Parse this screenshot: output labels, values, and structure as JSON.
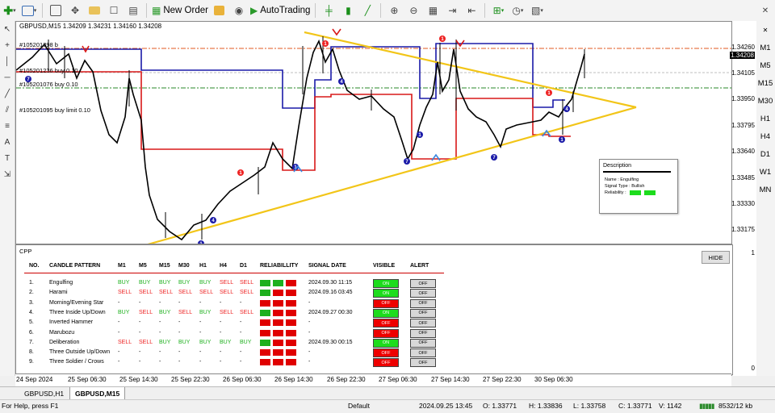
{
  "toolbar": {
    "new_order": "New Order",
    "autotrading": "AutoTrading"
  },
  "chart": {
    "title": "GBPUSD,M15  1.34209 1.34231 1.34160 1.34208",
    "orders": [
      "#105201398 b",
      "#105201236 buy 0.10",
      "#105201076 buy 0.10",
      "#105201095 buy limit 0.10"
    ],
    "price_labels": [
      "1.34260",
      "1.34208",
      "1.34105",
      "1.33950",
      "1.33795",
      "1.33640",
      "1.33485",
      "1.33330",
      "1.33175"
    ],
    "current_price": "1.34208"
  },
  "timeframes": [
    "M1",
    "M5",
    "M15",
    "M30",
    "H1",
    "H4",
    "D1",
    "W1",
    "MN"
  ],
  "description_box": {
    "title": "Description",
    "name": "Name : Engulfing",
    "signal_type": "Signal Type : Bullish",
    "reliability": "Reliability :"
  },
  "panel": {
    "title": "CPP",
    "hide_label": "HIDE",
    "headers": [
      "NO.",
      "CANDLE PATTERN",
      "M1",
      "M5",
      "M15",
      "M30",
      "H1",
      "H4",
      "D1",
      "RELIABILLITY",
      "SIGNAL DATE",
      "VISIBLE",
      "ALERT"
    ],
    "rows": [
      {
        "no": "1.",
        "name": "Engulfing",
        "sig": [
          "BUY",
          "BUY",
          "BUY",
          "BUY",
          "BUY",
          "SELL",
          "SELL"
        ],
        "rel": [
          "g",
          "g",
          "r"
        ],
        "date": "2024.09.30 11:15",
        "visible": "ON",
        "alert": "OFF"
      },
      {
        "no": "2.",
        "name": "Harami",
        "sig": [
          "SELL",
          "SELL",
          "SELL",
          "SELL",
          "SELL",
          "SELL",
          "SELL"
        ],
        "rel": [
          "g",
          "r",
          "r"
        ],
        "date": "2024.09.16 03:45",
        "visible": "ON",
        "alert": "OFF"
      },
      {
        "no": "3.",
        "name": "Morning/Evening Star",
        "sig": [
          "-",
          "-",
          "-",
          "-",
          "-",
          "-",
          "-"
        ],
        "rel": [
          "r",
          "r",
          "r"
        ],
        "date": "-",
        "visible": "OFF",
        "alert": "OFF"
      },
      {
        "no": "4.",
        "name": "Three Inside Up/Down",
        "sig": [
          "BUY",
          "SELL",
          "BUY",
          "SELL",
          "BUY",
          "SELL",
          "SELL"
        ],
        "rel": [
          "g",
          "r",
          "r"
        ],
        "date": "2024.09.27 00:30",
        "visible": "ON",
        "alert": "OFF"
      },
      {
        "no": "5.",
        "name": "Inverted Hammer",
        "sig": [
          "-",
          "-",
          "-",
          "-",
          "-",
          "-",
          "-"
        ],
        "rel": [
          "r",
          "r",
          "r"
        ],
        "date": "-",
        "visible": "OFF",
        "alert": "OFF"
      },
      {
        "no": "6.",
        "name": "Marubozu",
        "sig": [
          "-",
          "-",
          "-",
          "-",
          "-",
          "-",
          "-"
        ],
        "rel": [
          "r",
          "r",
          "r"
        ],
        "date": "-",
        "visible": "OFF",
        "alert": "OFF"
      },
      {
        "no": "7.",
        "name": "Deliberation",
        "sig": [
          "SELL",
          "SELL",
          "BUY",
          "BUY",
          "BUY",
          "BUY",
          "BUY"
        ],
        "rel": [
          "g",
          "r",
          "r"
        ],
        "date": "2024.09.30 00:15",
        "visible": "ON",
        "alert": "OFF"
      },
      {
        "no": "8.",
        "name": "Three Outside Up/Down",
        "sig": [
          "-",
          "-",
          "-",
          "-",
          "-",
          "-",
          "-"
        ],
        "rel": [
          "r",
          "r",
          "r"
        ],
        "date": "-",
        "visible": "OFF",
        "alert": "OFF"
      },
      {
        "no": "9.",
        "name": "Three Soldier / Crows",
        "sig": [
          "-",
          "-",
          "-",
          "-",
          "-",
          "-",
          "-"
        ],
        "rel": [
          "r",
          "r",
          "r"
        ],
        "date": "-",
        "visible": "OFF",
        "alert": "OFF"
      }
    ]
  },
  "time_axis": [
    "24 Sep 2024",
    "25 Sep 06:30",
    "25 Sep 14:30",
    "25 Sep 22:30",
    "26 Sep 06:30",
    "26 Sep 14:30",
    "26 Sep 22:30",
    "27 Sep 06:30",
    "27 Sep 14:30",
    "27 Sep 22:30",
    "30 Sep 06:30"
  ],
  "tabs": [
    "GBPUSD,H1",
    "GBPUSD,M15"
  ],
  "status": {
    "help": "For Help, press F1",
    "profile": "Default",
    "datetime": "2024.09.25 13:45",
    "open": "O: 1.33771",
    "high": "H: 1.33836",
    "low": "L: 1.33758",
    "close": "C: 1.33771",
    "volume": "V: 1142",
    "traffic": "8532/12 kb"
  },
  "colors": {
    "buy": "#1db01d",
    "sell": "#e22222",
    "trend": "#f2c518",
    "resistance": "#1a1aa8",
    "support": "#d81818"
  }
}
